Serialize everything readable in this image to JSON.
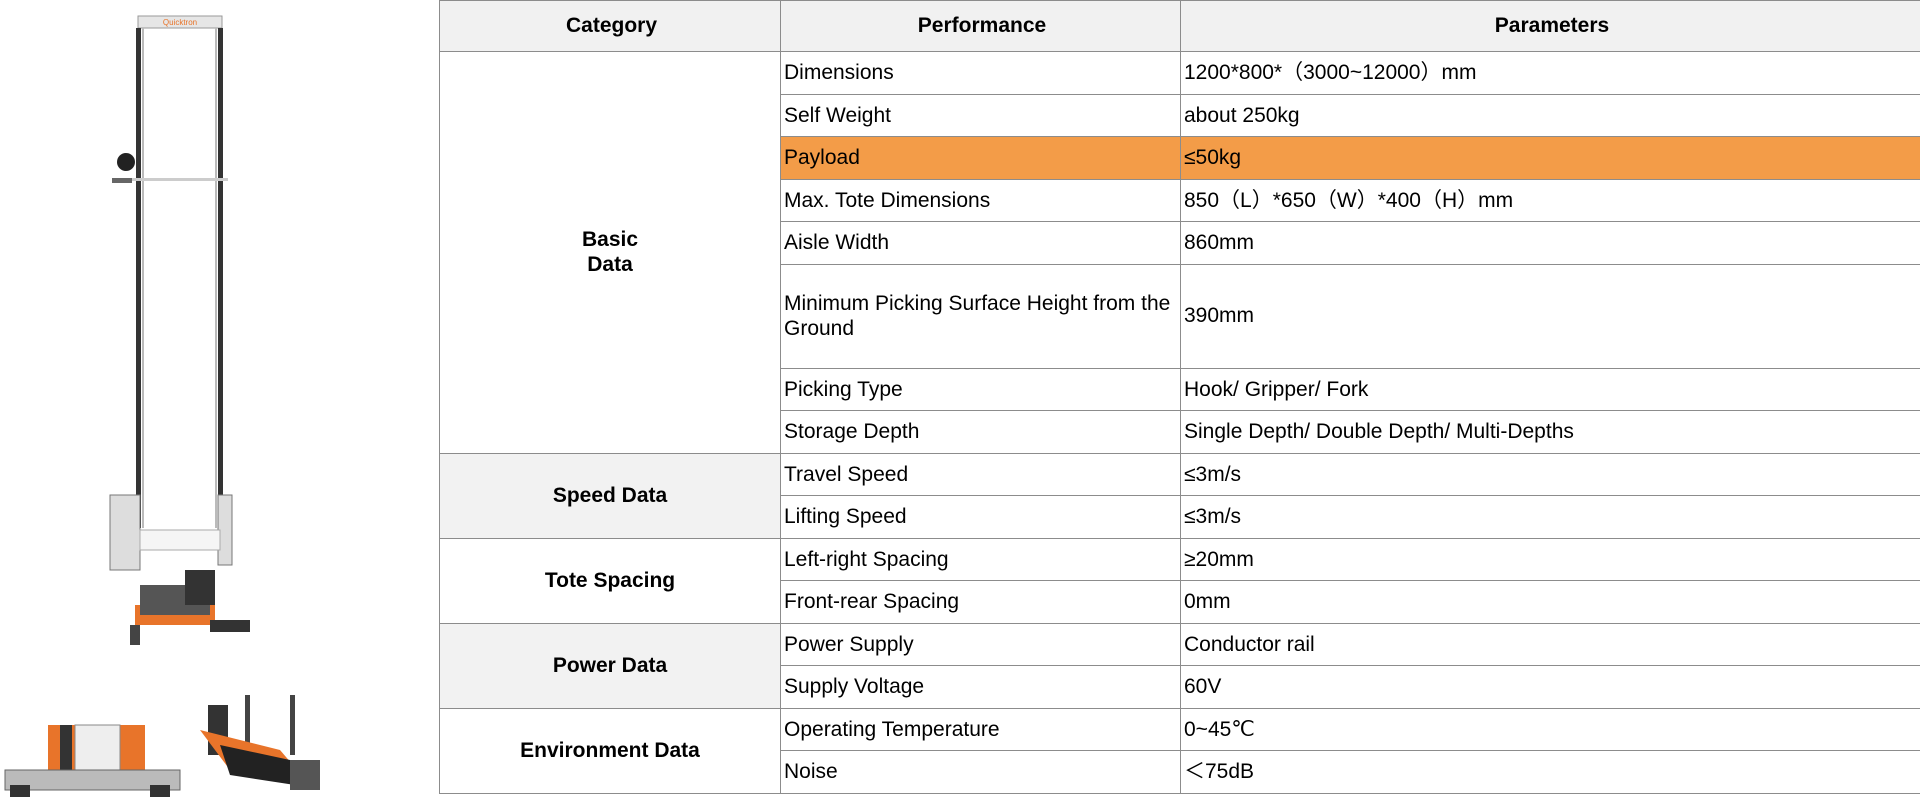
{
  "colors": {
    "highlight": "#f39c48",
    "header_bg": "#f1f1f1",
    "group_bg": "#f2f2f2",
    "border": "#8c8c8c"
  },
  "brand": {
    "logo_text": "Quicktron",
    "accent": "#e8742a"
  },
  "table": {
    "headers": {
      "category": "Category",
      "performance": "Performance",
      "parameters": "Parameters"
    },
    "groups": [
      {
        "category": "Basic Data",
        "category_lines": [
          "Basic",
          "Data"
        ],
        "rows": [
          {
            "performance": "Dimensions",
            "parameters": "1200*800*（3000~12000）mm"
          },
          {
            "performance": "Self Weight",
            "parameters": "about 250kg"
          },
          {
            "performance": "Payload",
            "parameters": "≤50kg",
            "highlighted": true
          },
          {
            "performance": "Max. Tote Dimensions",
            "parameters": "850（L）*650（W）*400（H）mm"
          },
          {
            "performance": "Aisle Width",
            "parameters": "860mm"
          },
          {
            "performance": "Minimum Picking Surface Height from the Ground",
            "parameters": "390mm"
          },
          {
            "performance": "Picking Type",
            "parameters": "Hook/ Gripper/ Fork"
          },
          {
            "performance": "Storage Depth",
            "parameters": "Single Depth/ Double Depth/ Multi-Depths"
          }
        ]
      },
      {
        "category": "Speed Data",
        "rows": [
          {
            "performance": "Travel Speed",
            "parameters": "≤3m/s"
          },
          {
            "performance": "Lifting Speed",
            "parameters": "≤3m/s"
          }
        ]
      },
      {
        "category": "Tote Spacing",
        "rows": [
          {
            "performance": "Left-right Spacing",
            "parameters": "≥20mm"
          },
          {
            "performance": "Front-rear Spacing",
            "parameters": "0mm"
          }
        ]
      },
      {
        "category": "Power Data",
        "rows": [
          {
            "performance": "Power Supply",
            "parameters": "Conductor rail"
          },
          {
            "performance": "Supply Voltage",
            "parameters": "60V"
          }
        ]
      },
      {
        "category": "Environment Data",
        "rows": [
          {
            "performance": "Operating Temperature",
            "parameters": "0~45℃"
          },
          {
            "performance": "Noise",
            "parameters": "＜75dB"
          }
        ]
      }
    ]
  }
}
